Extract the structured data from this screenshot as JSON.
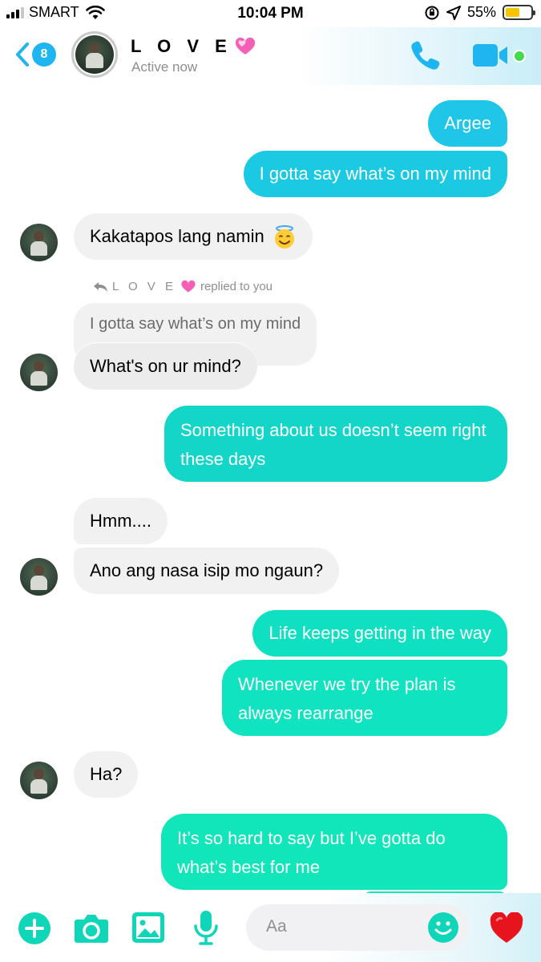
{
  "status_bar": {
    "carrier": "SMART",
    "time": "10:04 PM",
    "battery": "55%",
    "battery_level": 0.55
  },
  "header": {
    "back_badge": "8",
    "contact_name": "L O V E",
    "contact_status": "Active now",
    "icons": [
      "back-chevron-icon",
      "phone-icon",
      "video-camera-icon",
      "heart-emoji-icon"
    ],
    "colors": {
      "accent": "#1fb5f0",
      "active": "#44d94f"
    }
  },
  "messages": [
    {
      "from": "me",
      "text": "Argee"
    },
    {
      "from": "me",
      "text": "I gotta say what’s on my mind"
    },
    {
      "from": "them",
      "text": "Kakatapos lang namin",
      "emoji": "smiling-face-with-halo"
    },
    {
      "from": "them",
      "reply_label_name": "L O V E",
      "reply_label_suffix": "replied to you",
      "quoted": "I gotta say what’s on my mind",
      "text": "What's on ur mind?"
    },
    {
      "from": "me",
      "text": "Something about us doesn’t seem right these days"
    },
    {
      "from": "them",
      "text": "Hmm...."
    },
    {
      "from": "them",
      "text": "Ano ang nasa isip mo ngaun?"
    },
    {
      "from": "me",
      "text": "Life keeps getting in the way"
    },
    {
      "from": "me",
      "text": "Whenever we try the plan is always rearrange"
    },
    {
      "from": "them",
      "text": "Ha?"
    },
    {
      "from": "me",
      "text": "It’s so hard to say but I’ve gotta do what’s best for me"
    }
  ],
  "composer": {
    "placeholder": "Aa",
    "icons": [
      "plus-icon",
      "camera-icon",
      "image-icon",
      "microphone-icon",
      "smiley-icon",
      "heart-send-icon"
    ]
  }
}
